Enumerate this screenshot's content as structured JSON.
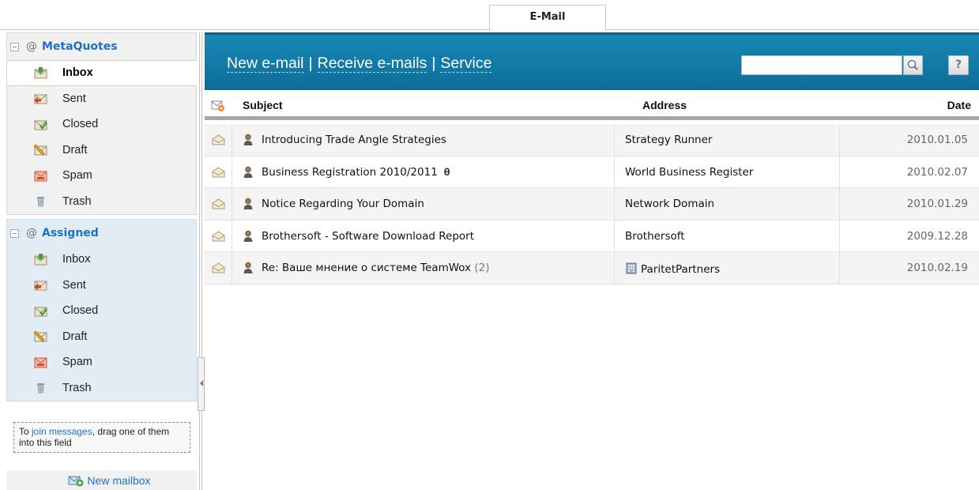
{
  "tabs": {
    "email": "E-Mail"
  },
  "sidebar": {
    "groups": [
      {
        "title": "MetaQuotes",
        "folders": [
          {
            "label": "Inbox",
            "icon": "inbox-icon"
          },
          {
            "label": "Sent",
            "icon": "sent-icon"
          },
          {
            "label": "Closed",
            "icon": "closed-icon"
          },
          {
            "label": "Draft",
            "icon": "draft-icon"
          },
          {
            "label": "Spam",
            "icon": "spam-icon"
          },
          {
            "label": "Trash",
            "icon": "trash-icon"
          }
        ]
      },
      {
        "title": "Assigned",
        "folders": [
          {
            "label": "Inbox",
            "icon": "inbox-icon"
          },
          {
            "label": "Sent",
            "icon": "sent-icon"
          },
          {
            "label": "Closed",
            "icon": "closed-icon"
          },
          {
            "label": "Draft",
            "icon": "draft-icon"
          },
          {
            "label": "Spam",
            "icon": "spam-icon"
          },
          {
            "label": "Trash",
            "icon": "trash-icon"
          }
        ]
      }
    ],
    "drop_zone": {
      "prefix": "To ",
      "link": "join messages",
      "suffix": ", drag one of them into this field"
    },
    "new_mailbox": "New mailbox"
  },
  "header": {
    "new_email": "New e-mail",
    "receive": "Receive e-mails",
    "service": "Service",
    "separator": "|",
    "search_value": "",
    "help": "?"
  },
  "columns": {
    "subject": "Subject",
    "address": "Address",
    "date": "Date"
  },
  "emails": [
    {
      "subject": "Introducing Trade Angle Strategies",
      "count": "",
      "attachment": false,
      "address": "Strategy Runner",
      "address_icon": "",
      "date": "2010.01.05"
    },
    {
      "subject": "Business Registration 2010/2011",
      "count": "",
      "attachment": true,
      "address": "World Business Register",
      "address_icon": "",
      "date": "2010.02.07"
    },
    {
      "subject": "Notice Regarding Your Domain",
      "count": "",
      "attachment": false,
      "address": "Network Domain",
      "address_icon": "",
      "date": "2010.01.29"
    },
    {
      "subject": "Brothersoft - Software Download Report",
      "count": "",
      "attachment": false,
      "address": "Brothersoft",
      "address_icon": "",
      "date": "2009.12.28"
    },
    {
      "subject": "Re: Ваше мнение о системе TeamWox",
      "count": "(2)",
      "attachment": false,
      "address": "ParitetPartners",
      "address_icon": "building-icon",
      "date": "2010.02.19"
    }
  ],
  "colors": {
    "accent": "#1f72c4",
    "header_bg": "#1887b5",
    "assigned_bg": "#e2ecf4"
  }
}
